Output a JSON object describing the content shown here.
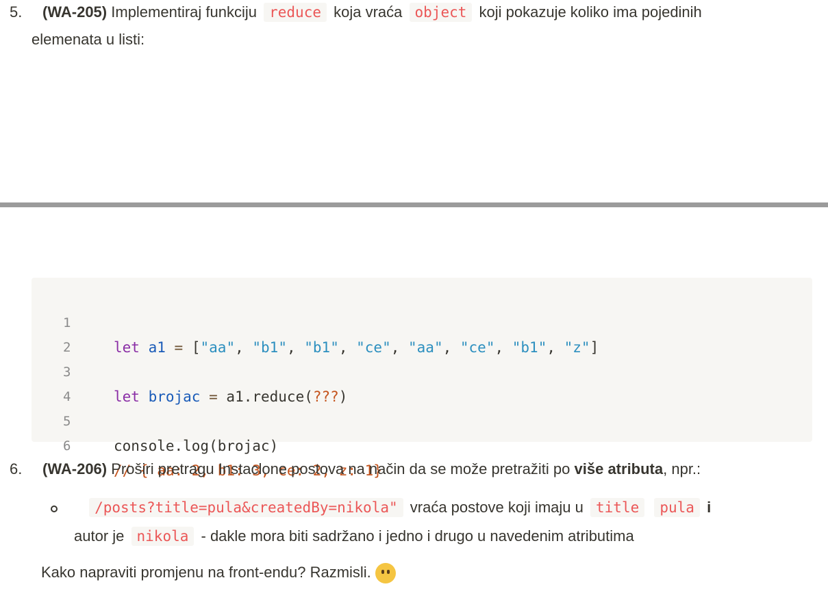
{
  "item5": {
    "number": "5.",
    "id": "(WA-205)",
    "text1": "Implementiraj funkciju",
    "code1": "reduce",
    "text2": "koja vraća",
    "code2": "object",
    "text3": "koji pokazuje koliko ima pojedinih",
    "line2": "elemenata u listi:"
  },
  "code_block": {
    "lines": [
      {
        "n": "1",
        "kw": "let",
        "var": "a1",
        "eq": "=",
        "rest_open": "[",
        "strings": [
          "\"aa\"",
          "\"b1\"",
          "\"b1\"",
          "\"ce\"",
          "\"aa\"",
          "\"ce\"",
          "\"b1\"",
          "\"z\""
        ],
        "close": "]"
      },
      {
        "n": "2"
      },
      {
        "n": "3",
        "kw": "let",
        "var": "brojac",
        "eq": "=",
        "call": "a1.reduce(",
        "q": "???",
        "close": ")"
      },
      {
        "n": "4"
      },
      {
        "n": "5",
        "text": "console.log(brojac)"
      },
      {
        "n": "6",
        "comment": "// { aa: 2, b1: 3, ce: 2, z: 1}"
      }
    ]
  },
  "item6": {
    "number": "6.",
    "id": "(WA-206)",
    "text1": "Proširi pretragu Instaclone postova na način da se može pretražiti po",
    "bold": "više atributa",
    "text2": ", npr.:",
    "sub": {
      "code1": "/posts?title=pula&createdBy=nikola\"",
      "text1": "vraća postove koji imaju u",
      "code2": "title",
      "code3": "pula",
      "bold": "i",
      "text2": "autor je",
      "code4": "nikola",
      "text3": "- dakle mora biti sadržano i jedno i drugo u navedenim atributima"
    },
    "closing": "Kako napraviti promjenu na front-endu? Razmisli."
  },
  "icons": {
    "closing_emoji": "thinking-face-icon"
  }
}
